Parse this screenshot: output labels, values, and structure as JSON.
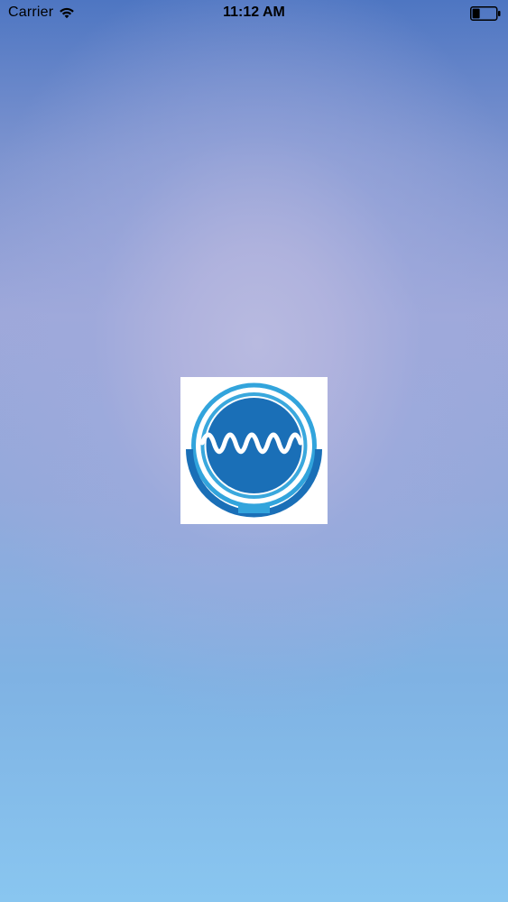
{
  "status_bar": {
    "carrier": "Carrier",
    "time": "11:12 AM",
    "icons": {
      "wifi": "wifi-icon",
      "battery": "battery-icon"
    }
  },
  "splash": {
    "logo": "app-logo",
    "colors": {
      "logo_dark_blue": "#1a6fb7",
      "logo_light_blue": "#32a4dc"
    }
  }
}
